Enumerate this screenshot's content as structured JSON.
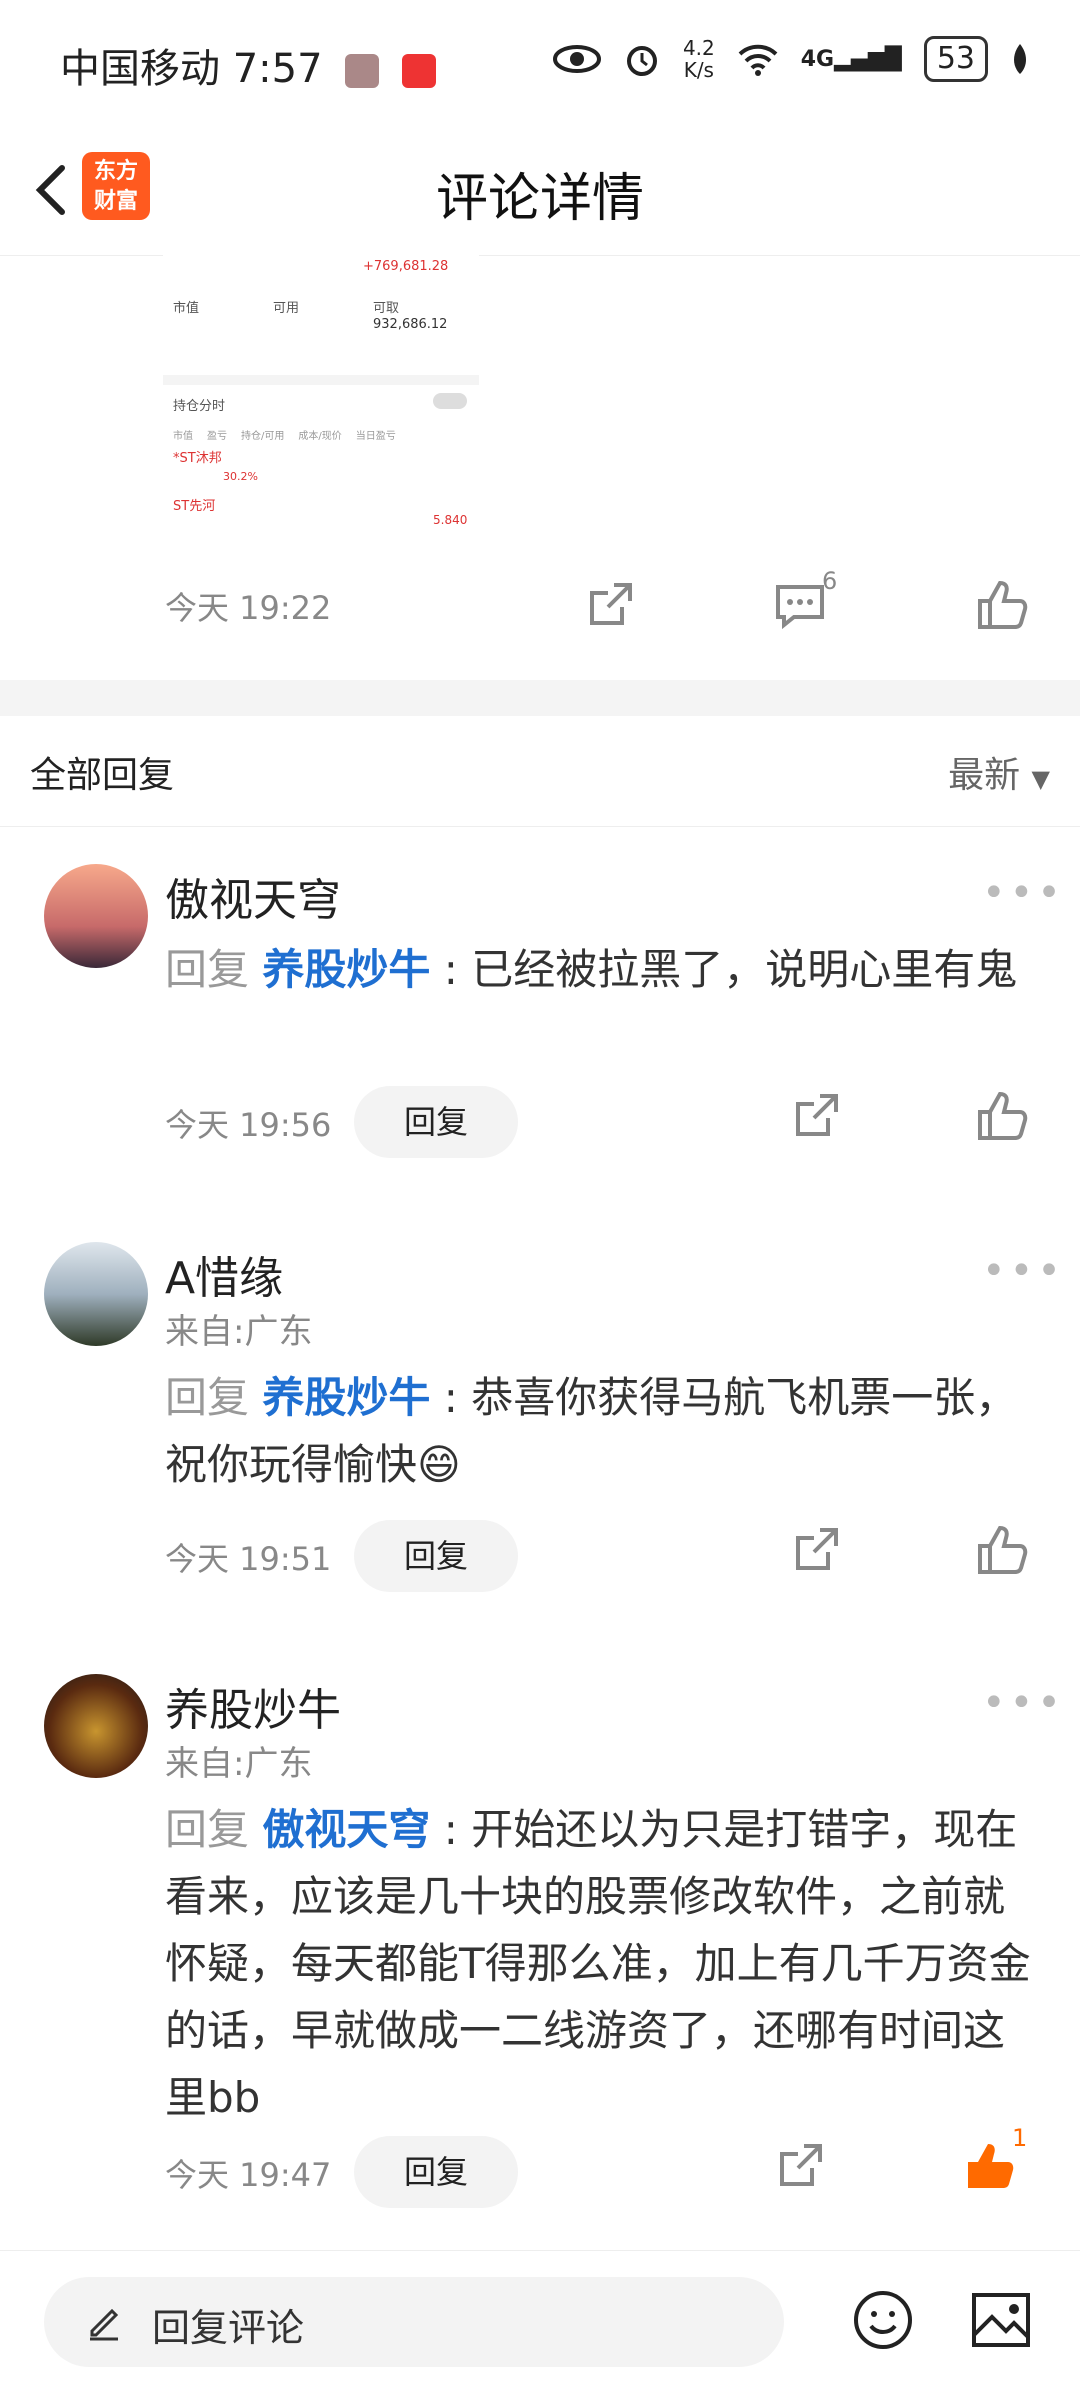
{
  "status_bar": {
    "carrier_time": "中国移动 7:57",
    "speed": "4.2\nK/s",
    "network": "4G",
    "battery": "53"
  },
  "header": {
    "logo_text": "东方\n财富",
    "title": "评论详情"
  },
  "post": {
    "image": {
      "value1": "+769,681.28",
      "col_labels": [
        "市值",
        "可用",
        "可取"
      ],
      "available": "932,686.12",
      "toggle_label": "持仓分时",
      "table_header": [
        "市值",
        "盈亏",
        "持仓/可用",
        "成本/现价",
        "当日盈亏"
      ],
      "stocks": [
        {
          "name": "*ST沐邦",
          "extra": "30.2%"
        },
        {
          "name": "ST先河",
          "extra": "5.840"
        }
      ]
    },
    "time": "今天 19:22",
    "comment_count": "6"
  },
  "section": {
    "label": "全部回复",
    "sort": "最新"
  },
  "comments": [
    {
      "name": "傲视天穹",
      "location": "",
      "prefix": "回复 ",
      "mention": "养股炒牛",
      "text": " : 已经被拉黑了，说明心里有鬼",
      "time": "今天 19:56",
      "reply_label": "回复",
      "likes": ""
    },
    {
      "name": "A惜缘",
      "location": "来自:广东",
      "prefix": "回复 ",
      "mention": "养股炒牛",
      "text": " : 恭喜你获得马航飞机票一张，祝你玩得愉快😄",
      "time": "今天 19:51",
      "reply_label": "回复",
      "likes": ""
    },
    {
      "name": "养股炒牛",
      "location": "来自:广东",
      "prefix": "回复 ",
      "mention": "傲视天穹",
      "text": " : 开始还以为只是打错字，现在看来，应该是几十块的股票修改软件，之前就怀疑，每天都能T得那么准，加上有几千万资金的话，早就做成一二线游资了，还哪有时间这里bb",
      "time": "今天 19:47",
      "reply_label": "回复",
      "likes": "1"
    }
  ],
  "bottom_bar": {
    "placeholder": "回复评论"
  },
  "colors": {
    "accent": "#1f6fd1",
    "brand": "#ff5a1f",
    "liked": "#ff6a00"
  }
}
